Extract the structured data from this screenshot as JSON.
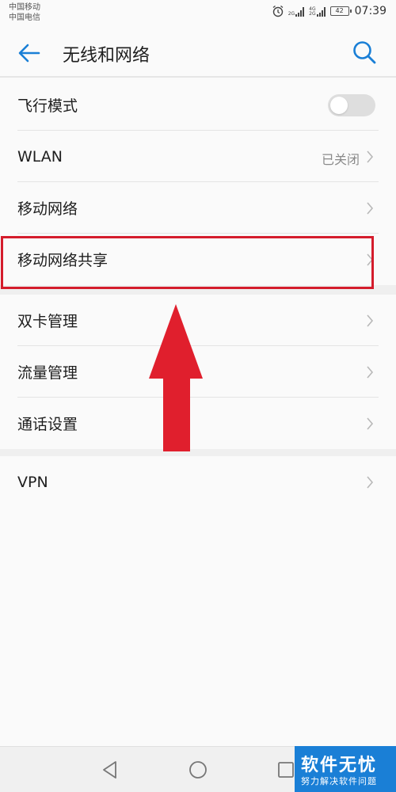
{
  "status_bar": {
    "carrier_1": "中国移动",
    "carrier_2": "中国电信",
    "signal_tag_1": "2G",
    "signal_tag_2a": "4G",
    "signal_tag_2b": "2G",
    "battery": "42",
    "time": "07:39"
  },
  "header": {
    "title": "无线和网络",
    "back_icon": "arrow-left-icon",
    "search_icon": "search-icon"
  },
  "section_1": [
    {
      "label": "飞行模式",
      "control": "toggle",
      "toggle_on": false
    },
    {
      "label": "WLAN",
      "value": "已关闭",
      "control": "chevron"
    },
    {
      "label": "移动网络",
      "control": "chevron"
    },
    {
      "label": "移动网络共享",
      "control": "chevron",
      "highlighted": true
    }
  ],
  "section_2": [
    {
      "label": "双卡管理",
      "control": "chevron"
    },
    {
      "label": "流量管理",
      "control": "chevron"
    },
    {
      "label": "通话设置",
      "control": "chevron"
    }
  ],
  "section_3": [
    {
      "label": "VPN",
      "control": "chevron"
    }
  ],
  "annotation": {
    "highlight_color": "#d41c2c",
    "arrow_color": "#e01f2d"
  },
  "nav_bar": {
    "back_icon": "triangle-back-icon",
    "home_icon": "circle-home-icon",
    "recent_icon": "square-recent-icon"
  },
  "watermark": {
    "title": "软件无忧",
    "subtitle": "努力解决软件问题"
  },
  "colors": {
    "accent": "#1a7fd6",
    "background": "#fafafa",
    "section_gap": "#efefef"
  }
}
